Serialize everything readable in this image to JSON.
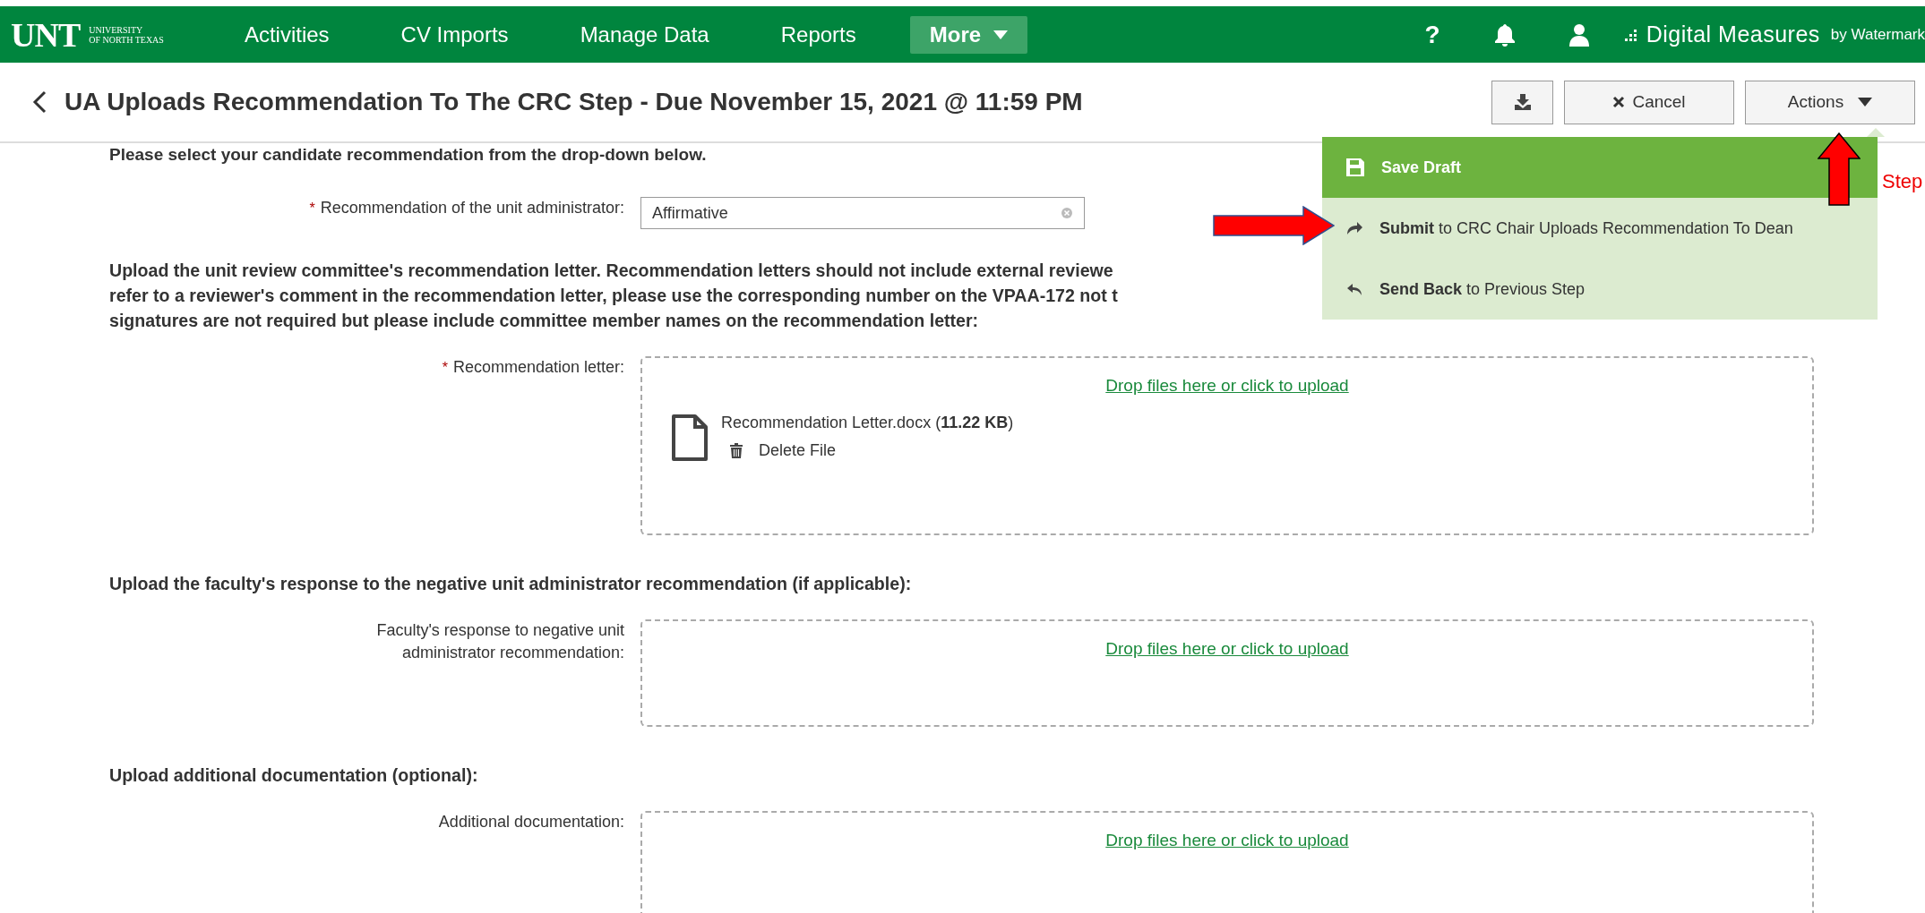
{
  "nav": {
    "logo": "UNT",
    "logo_line_1": "UNIVERSITY",
    "logo_line_2": "OF NORTH TEXAS",
    "items": [
      {
        "label": "Activities",
        "kind": "link"
      },
      {
        "label": "CV Imports",
        "kind": "link"
      },
      {
        "label": "Manage Data",
        "kind": "link"
      },
      {
        "label": "Reports",
        "kind": "link"
      },
      {
        "label": "More",
        "kind": "dropdown"
      }
    ],
    "icons": [
      {
        "kind": "help",
        "text": "?"
      },
      {
        "kind": "bell"
      },
      {
        "kind": "user"
      }
    ],
    "brand": "Digital Measures",
    "brand_suffix": "by Watermark"
  },
  "header": {
    "title": "UA Uploads Recommendation To The CRC Step - Due November 15, 2021 @ 11:59 PM",
    "buttons": [
      {
        "kind": "download"
      },
      {
        "kind": "cancel",
        "label": "Cancel"
      },
      {
        "kind": "dropdown",
        "label": "Actions"
      }
    ]
  },
  "actions_menu": {
    "items": [
      {
        "kind": "save",
        "label": "Save Draft",
        "highlighted": true
      },
      {
        "kind": "submit",
        "label": "**Submit** to CRC Chair Uploads Recommendation To Dean",
        "highlighted": false
      },
      {
        "kind": "back",
        "label": "**Send Back** to Previous Step",
        "highlighted": false
      }
    ]
  },
  "intro": "Please select your candidate recommendation from the drop-down below.",
  "sections": [
    {
      "kind": "select",
      "required_mark": "*",
      "label": "Recommendation of the unit administrator:",
      "value": "Affirmative"
    },
    {
      "kind": "heading",
      "lines": [
        "Upload the unit review committee's recommendation letter. Recommendation letters should not include external reviewe",
        "refer to a reviewer's comment in the recommendation letter, please use the corresponding number on the VPAA-172 not t",
        "signatures are not required but please include committee member names on the recommendation letter:"
      ]
    },
    {
      "kind": "upload",
      "required_mark": "*",
      "label": "Recommendation letter:",
      "link": "Drop files here or click to upload",
      "files": [
        {
          "name": "Recommendation Letter.docx (**11.22 KB**)",
          "action": "Delete File"
        }
      ]
    },
    {
      "kind": "heading",
      "lines": [
        "Upload the faculty's response to the negative unit administrator recommendation (if applicable):"
      ]
    },
    {
      "kind": "upload",
      "label": "Faculty's response to negative unit administrator recommendation:",
      "link": "Drop files here or click to upload"
    },
    {
      "kind": "heading",
      "lines": [
        "Upload additional documentation (optional):"
      ]
    },
    {
      "kind": "upload",
      "label": "Additional documentation:",
      "link": "Drop files here or click to upload"
    }
  ],
  "annotations": [
    {
      "kind": "arrow-right"
    },
    {
      "kind": "arrow-up"
    },
    {
      "kind": "label",
      "text": "Step"
    }
  ]
}
